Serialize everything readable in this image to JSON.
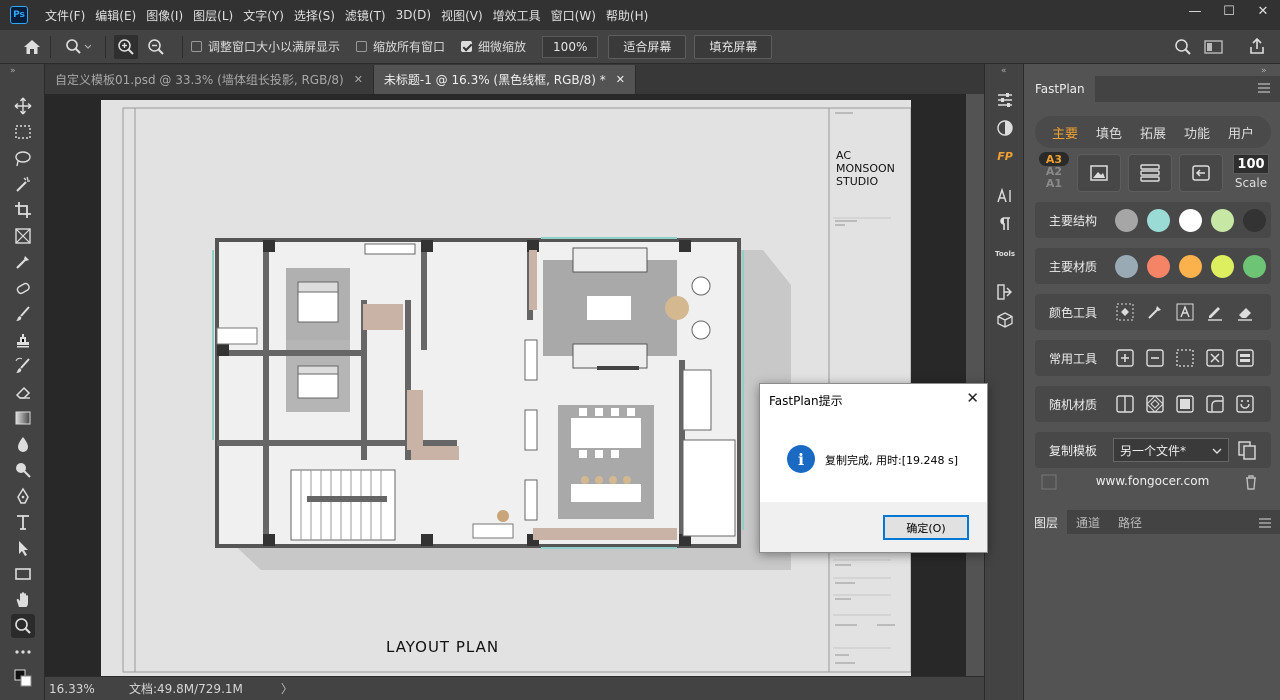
{
  "app": {
    "logo": "Ps"
  },
  "menu": [
    "文件(F)",
    "编辑(E)",
    "图像(I)",
    "图层(L)",
    "文字(Y)",
    "选择(S)",
    "滤镜(T)",
    "3D(D)",
    "视图(V)",
    "增效工具",
    "窗口(W)",
    "帮助(H)"
  ],
  "window_controls": {
    "min": "—",
    "max": "☐",
    "close": "✕"
  },
  "options": {
    "resize_window": "调整窗口大小以满屏显示",
    "zoom_all": "缩放所有窗口",
    "scrubby_zoom": "细微缩放",
    "zoom_value": "100%",
    "fit_screen": "适合屏幕",
    "fill_screen": "填充屏幕"
  },
  "tabs": [
    {
      "label": "自定义模板01.psd @ 33.3% (墙体组长投影, RGB/8)",
      "close": "✕"
    },
    {
      "label": "未标题-1 @ 16.3% (黑色线框, RGB/8) *",
      "close": "✕"
    }
  ],
  "document": {
    "studio_line1": "AC",
    "studio_line2": "MONSOON",
    "studio_line3": "STUDIO",
    "plan_title": "LAYOUT PLAN"
  },
  "status": {
    "zoom": "16.33%",
    "doc_info": "文档:49.8M/729.1M",
    "arrow": "〉"
  },
  "mid_panel": {
    "fp_label": "FP",
    "tools_label": "Tools"
  },
  "fastplan": {
    "panel_title": "FastPlan",
    "nav": [
      "主要",
      "填色",
      "拓展",
      "功能",
      "用户"
    ],
    "sizes": [
      "A3",
      "A2",
      "A1"
    ],
    "scale_value": "100",
    "scale_label": "Scale",
    "rows": {
      "main_structure": "主要结构",
      "main_material": "主要材质",
      "color_tools": "颜色工具",
      "common_tools": "常用工具",
      "random_material": "随机材质",
      "copy_template": "复制模板"
    },
    "structure_colors": [
      "#a6a6a6",
      "#9bdbd6",
      "#ffffff",
      "#c6e8a4",
      "#333333"
    ],
    "material_colors": [
      "#9aaab4",
      "#f58466",
      "#fbb24c",
      "#ddef5e",
      "#6cc474"
    ],
    "template_select": "另一个文件*",
    "website": "www.fongocer.com"
  },
  "layers_tabs": [
    "图层",
    "通道",
    "路径"
  ],
  "dialog": {
    "title": "FastPlan提示",
    "close": "✕",
    "icon": "i",
    "message": "复制完成, 用时:[19.248 s]",
    "ok": "确定(O)"
  }
}
